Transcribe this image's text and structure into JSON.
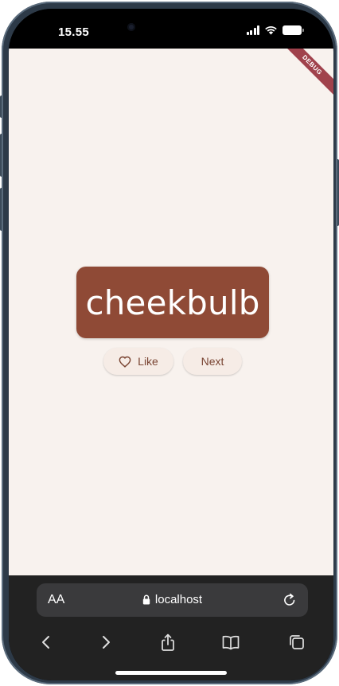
{
  "status_bar": {
    "time": "15.55",
    "icons": [
      "signal-icon",
      "wifi-icon",
      "battery-icon"
    ]
  },
  "app": {
    "debug_banner": "DEBUG",
    "word": "cheekbulb",
    "like_label": "Like",
    "next_label": "Next",
    "colors": {
      "background": "#f8f2ee",
      "card": "#8f4a36",
      "button_text": "#7a4533",
      "debug_ribbon": "#a0424c"
    }
  },
  "browser": {
    "text_size_label": "AA",
    "url": "localhost",
    "toolbar": [
      "back-icon",
      "forward-icon",
      "share-icon",
      "bookmarks-icon",
      "tabs-icon"
    ]
  }
}
